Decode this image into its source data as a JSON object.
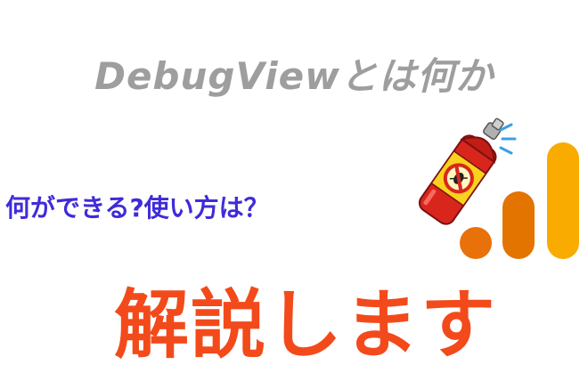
{
  "title": {
    "text": "DebugViewとは何か",
    "color": "#9e9e9e"
  },
  "subtitle": {
    "text": "何ができる?使い方は？",
    "color": "#3f2bd8"
  },
  "headline": {
    "text": "解説します",
    "color": "#f34a1b"
  },
  "images": {
    "spray_icon": "bug-spray-can-icon",
    "analytics_logo": "google-analytics-logo-icon",
    "logo_colors": [
      "#e8710a",
      "#e37400",
      "#f9ab00"
    ],
    "spray_colors": {
      "can": "#d9261c",
      "label": "#f8d21c",
      "cap": "#b0b0b0",
      "mist": "#3aa0e0"
    }
  }
}
